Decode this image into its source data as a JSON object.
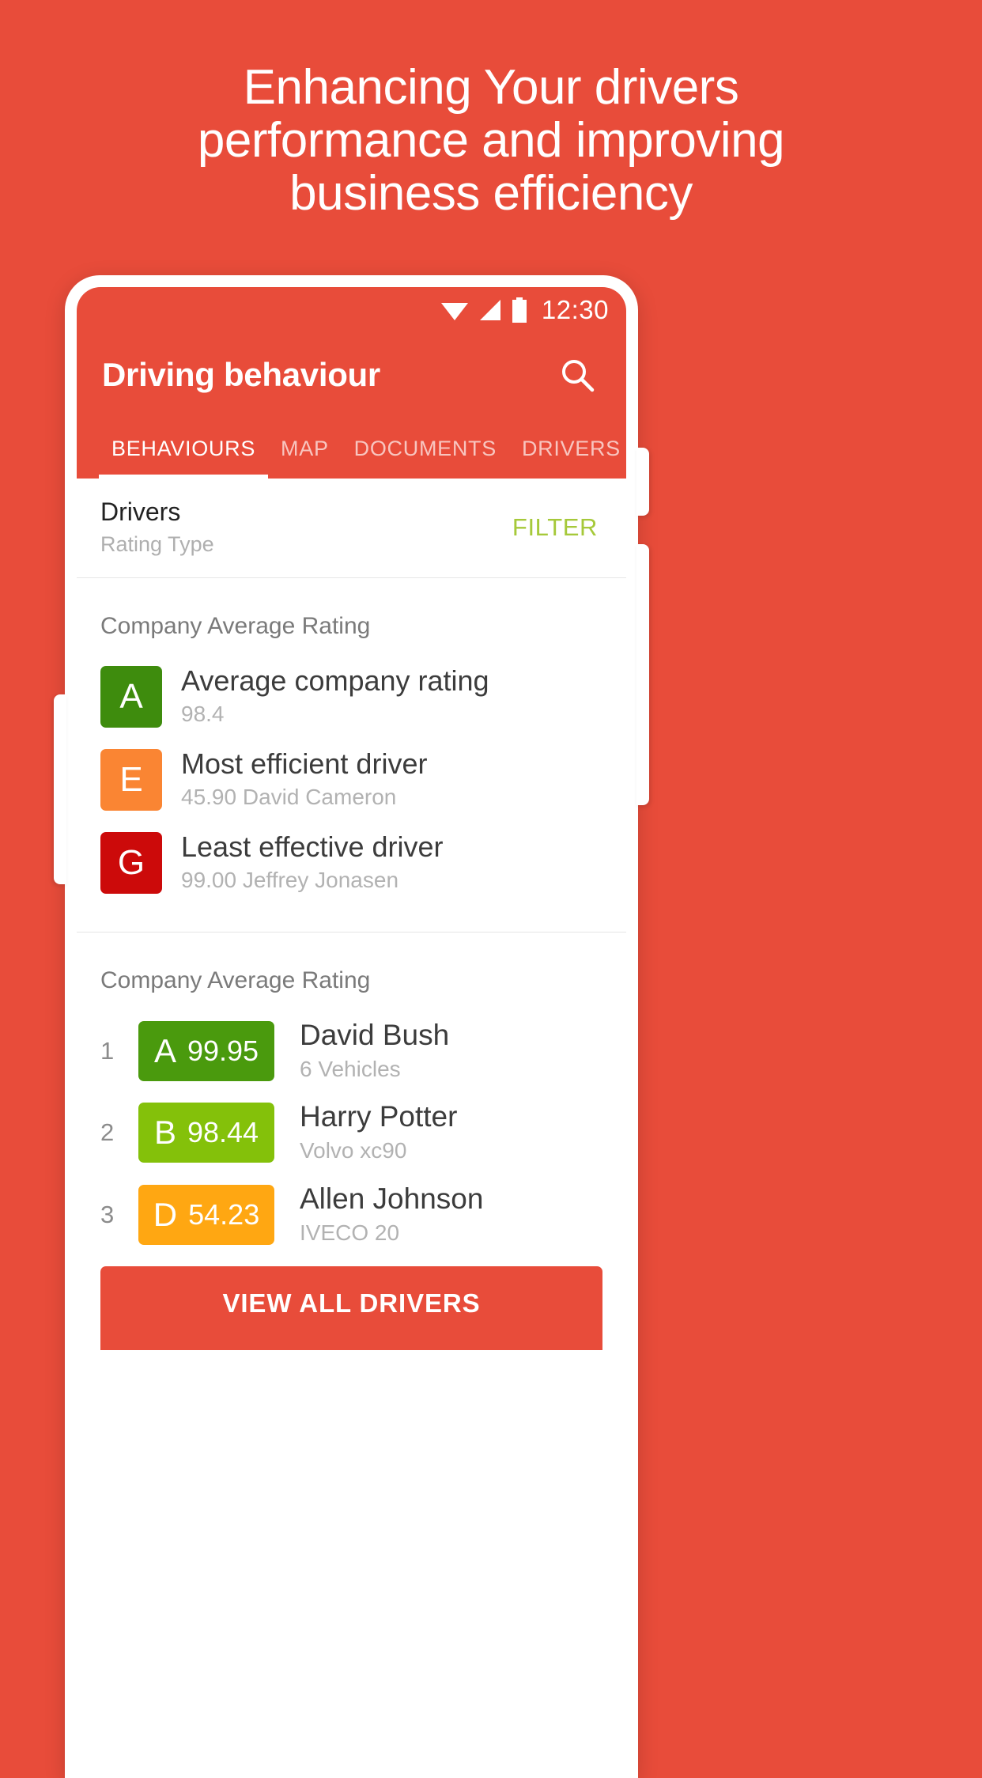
{
  "promo": {
    "headline_lines": [
      "Enhancing Your drivers",
      "performance and improving",
      "business efficiency"
    ],
    "background_color": "#E84C3A"
  },
  "status_bar": {
    "clock": "12:30",
    "icons": [
      "wifi-icon",
      "cellular-signal-icon",
      "battery-icon"
    ]
  },
  "app_bar": {
    "title": "Driving behaviour",
    "search_icon": "search-icon"
  },
  "tabs": [
    {
      "label": "BEHAVIOURS",
      "active": true
    },
    {
      "label": "MAP",
      "active": false
    },
    {
      "label": "DOCUMENTS",
      "active": false
    },
    {
      "label": "DRIVERS",
      "active": false
    }
  ],
  "filter_row": {
    "title": "Drivers",
    "subtitle": "Rating Type",
    "action_label": "FILTER",
    "action_color": "#A6C93A"
  },
  "summary_card": {
    "title": "Company Average Rating",
    "items": [
      {
        "grade": "A",
        "color": "#3E8C0D",
        "label": "Average company rating",
        "value": "98.4"
      },
      {
        "grade": "E",
        "color": "#FA8533",
        "label": "Most efficient driver",
        "value": "45.90 David Cameron"
      },
      {
        "grade": "G",
        "color": "#CC0A0A",
        "label": "Least effective driver",
        "value": "99.00 Jeffrey Jonasen"
      }
    ]
  },
  "ranking_card": {
    "title": "Company Average Rating",
    "rows": [
      {
        "rank": "1",
        "grade": "A",
        "score": "99.95",
        "color": "#4A9A0D",
        "name": "David Bush",
        "detail": "6 Vehicles"
      },
      {
        "rank": "2",
        "grade": "B",
        "score": "98.44",
        "color": "#84C10A",
        "name": "Harry Potter",
        "detail": "Volvo xc90"
      },
      {
        "rank": "3",
        "grade": "D",
        "score": "54.23",
        "color": "#FFA712",
        "name": "Allen Johnson",
        "detail": "IVECO 20"
      }
    ],
    "view_all_label": "VIEW ALL DRIVERS"
  }
}
